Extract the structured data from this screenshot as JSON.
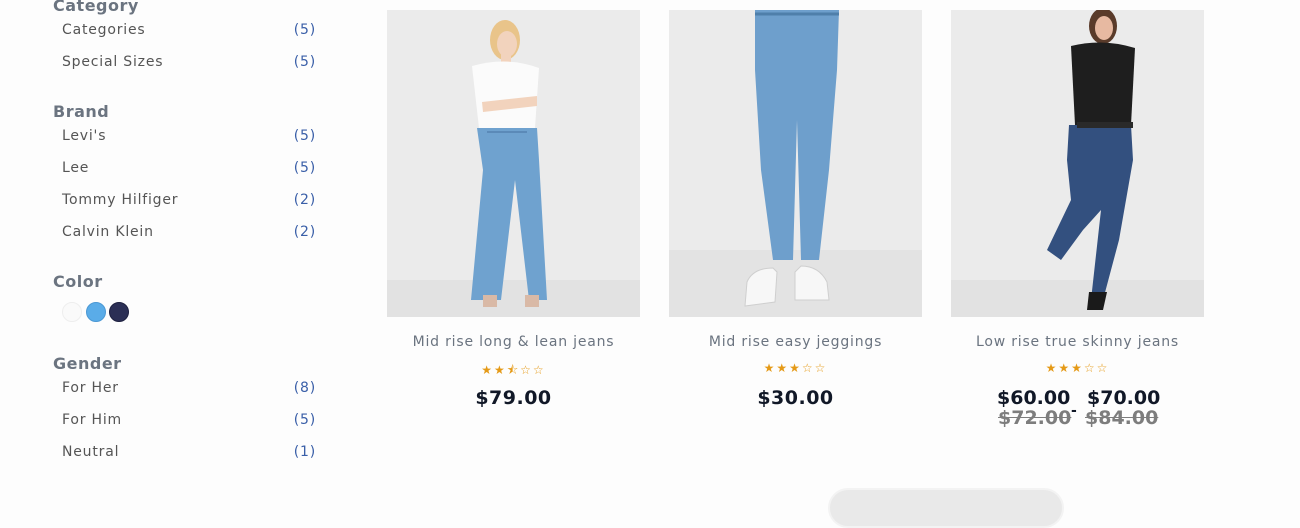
{
  "filters": {
    "category": {
      "title": "Category",
      "items": [
        {
          "label": "Categories",
          "count": "(5)"
        },
        {
          "label": "Special Sizes",
          "count": "(5)"
        }
      ]
    },
    "brand": {
      "title": "Brand",
      "items": [
        {
          "label": "Levi's",
          "count": "(5)"
        },
        {
          "label": "Lee",
          "count": "(5)"
        },
        {
          "label": "Tommy Hilfiger",
          "count": "(2)"
        },
        {
          "label": "Calvin Klein",
          "count": "(2)"
        }
      ]
    },
    "color": {
      "title": "Color",
      "swatches": [
        "#fafafa",
        "#5aace8",
        "#2b2f55"
      ]
    },
    "gender": {
      "title": "Gender",
      "items": [
        {
          "label": "For Her",
          "count": "(8)"
        },
        {
          "label": "For Him",
          "count": "(5)"
        },
        {
          "label": "Neutral",
          "count": "(1)"
        }
      ]
    }
  },
  "products": [
    {
      "name": "Mid rise long & lean jeans",
      "rating": 2.5,
      "stars": "★★⯪☆☆",
      "price": "$79.00"
    },
    {
      "name": "Mid rise easy jeggings",
      "rating": 3,
      "stars": "★★★☆☆",
      "price": "$30.00"
    },
    {
      "name": "Low rise true skinny jeans",
      "rating": 3,
      "stars": "★★★☆☆",
      "price_min": "$60.00",
      "price_max": "$70.00",
      "old_price_min": "$72.00",
      "old_price_max": "$84.00",
      "range_separator": "-"
    }
  ],
  "colors": {
    "accent_count": "#3a5fa8",
    "star": "#e59a17",
    "price": "#111827"
  }
}
